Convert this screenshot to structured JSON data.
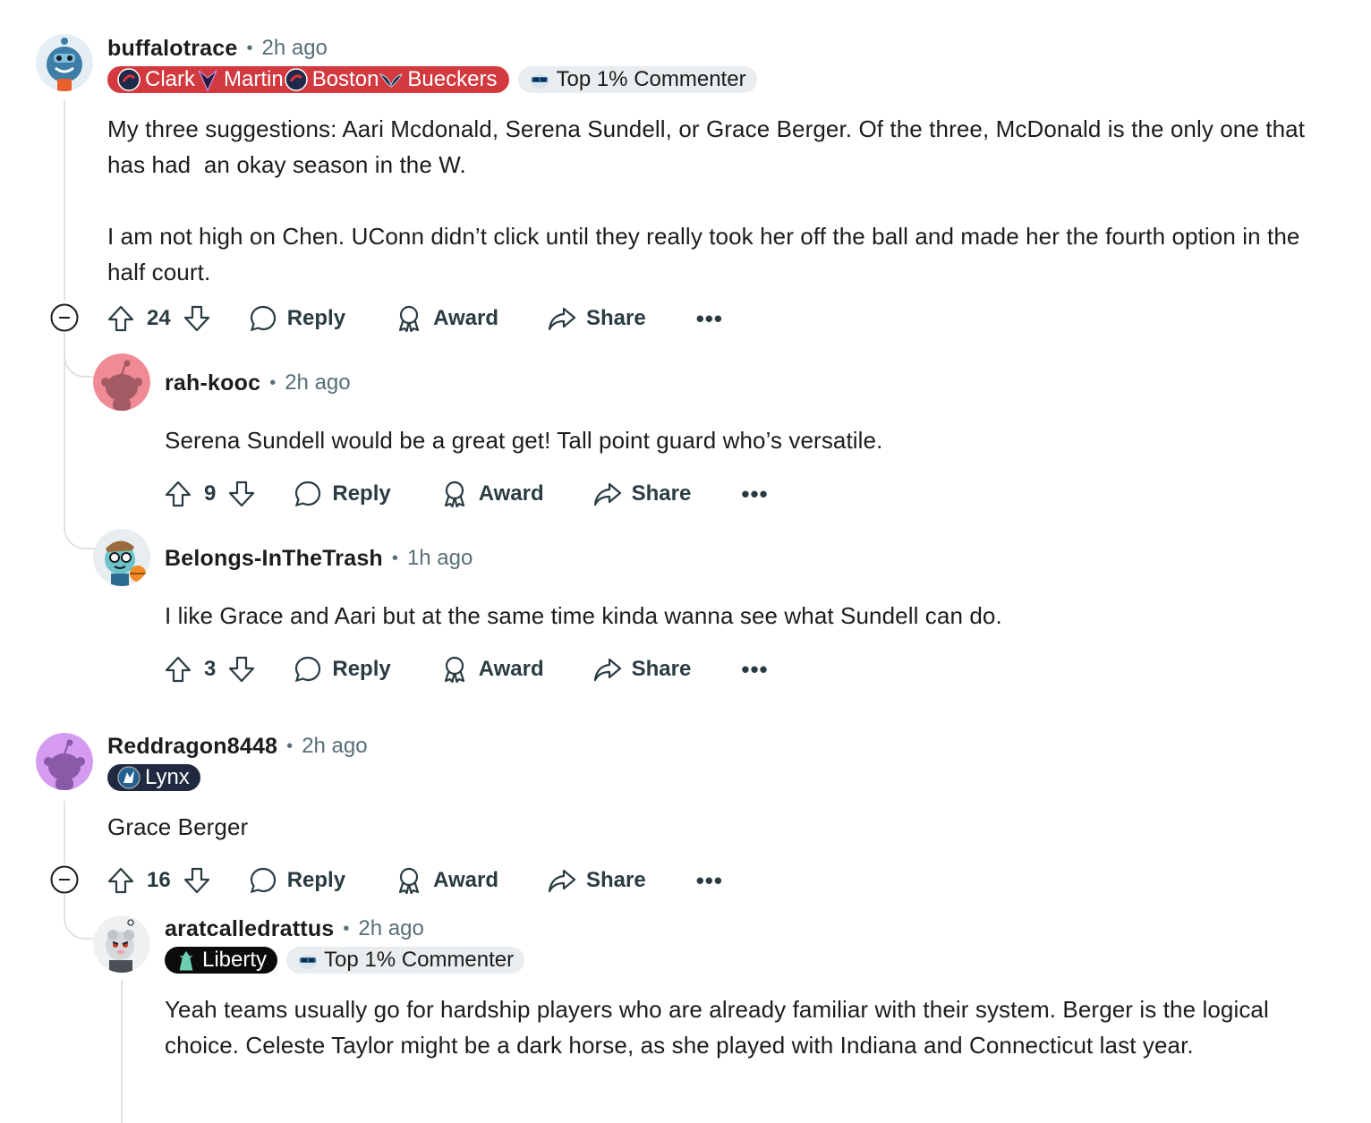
{
  "comments": [
    {
      "username": "buffalotrace",
      "time": "2h ago",
      "flairs": [
        {
          "label": "Clark"
        },
        {
          "label": "Martin"
        },
        {
          "label": "Boston"
        },
        {
          "label": "Bueckers"
        }
      ],
      "badge": "Top 1% Commenter",
      "body": "My three suggestions: Aari Mcdonald, Serena Sundell, or Grace Berger. Of the three, McDonald is the only one that has had  an okay season in the W.\n\nI am not high on Chen. UConn didn’t click until they really took her off the ball and made her the fourth option in the half court.",
      "score": "24"
    },
    {
      "username": "rah-kooc",
      "time": "2h ago",
      "body": "Serena Sundell would be a great get! Tall point guard who’s versatile.",
      "score": "9"
    },
    {
      "username": "Belongs-InTheTrash",
      "time": "1h ago",
      "body": "I like Grace and Aari but at the same time kinda wanna see what Sundell can do.",
      "score": "3"
    },
    {
      "username": "Reddragon8448",
      "time": "2h ago",
      "flair": "Lynx",
      "body": "Grace Berger",
      "score": "16"
    },
    {
      "username": "aratcalledrattus",
      "time": "2h ago",
      "flair": "Liberty",
      "badge": "Top 1% Commenter",
      "body": "Yeah teams usually go for hardship players who are already familiar with their system. Berger is the logical choice. Celeste Taylor might be a dark horse, as she played with Indiana and Connecticut last year."
    }
  ],
  "actions": {
    "reply": "Reply",
    "award": "Award",
    "share": "Share",
    "more": "•••"
  },
  "separator": "•",
  "colors": {
    "fever_flair": "#d23a3f",
    "lynx_flair": "#1f2940",
    "liberty_flair": "#0b0b0b",
    "badge_bg": "#eaedef",
    "action_text": "#2a3c42",
    "meta_text": "#576f76"
  }
}
